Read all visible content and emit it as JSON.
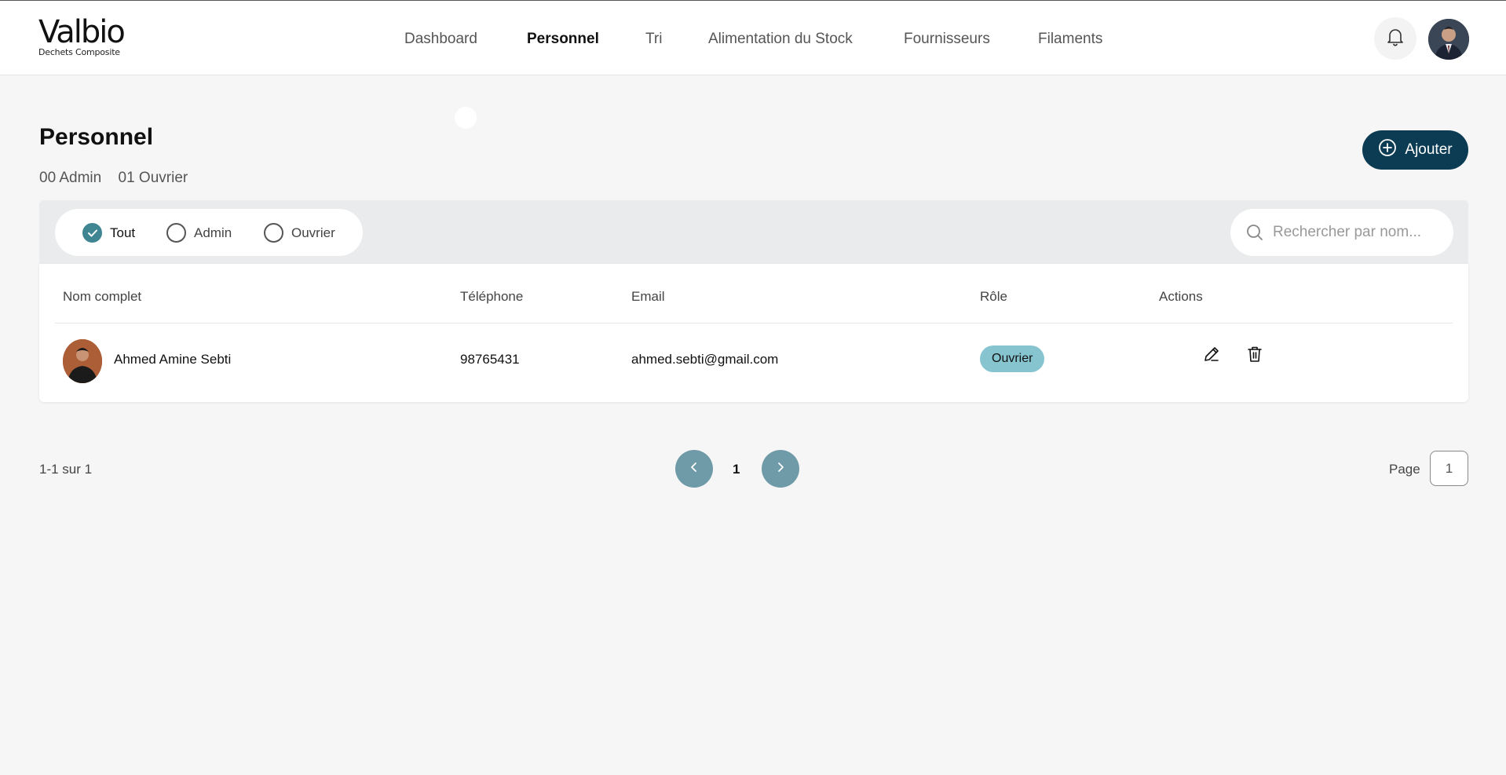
{
  "brand": {
    "name": "Valbio",
    "tagline": "Dechets Composite"
  },
  "nav": {
    "items": [
      {
        "label": "Dashboard",
        "active": false
      },
      {
        "label": "Personnel",
        "active": true
      },
      {
        "label": "Tri",
        "active": false
      },
      {
        "label": "Alimentation du Stock",
        "active": false
      },
      {
        "label": "Fournisseurs",
        "active": false
      },
      {
        "label": "Filaments",
        "active": false
      }
    ]
  },
  "page": {
    "title": "Personnel",
    "counts": {
      "admin": "00 Admin",
      "ouvrier": "01 Ouvrier"
    },
    "add_label": "Ajouter"
  },
  "filters": {
    "options": [
      {
        "label": "Tout",
        "checked": true
      },
      {
        "label": "Admin",
        "checked": false
      },
      {
        "label": "Ouvrier",
        "checked": false
      }
    ],
    "search_placeholder": "Rechercher par nom..."
  },
  "table": {
    "headers": {
      "name": "Nom complet",
      "phone": "Téléphone",
      "email": "Email",
      "role": "Rôle",
      "actions": "Actions"
    },
    "rows": [
      {
        "name": "Ahmed Amine Sebti",
        "phone": "98765431",
        "email": "ahmed.sebti@gmail.com",
        "role": "Ouvrier"
      }
    ]
  },
  "pagination": {
    "range": "1-1 sur 1",
    "current": "1",
    "page_label": "Page",
    "page_value": "1"
  },
  "colors": {
    "primary": "#0c3c53",
    "radio_checked": "#3f8592",
    "role_badge": "#86c5d0",
    "pager_button": "#6f9aa8"
  }
}
